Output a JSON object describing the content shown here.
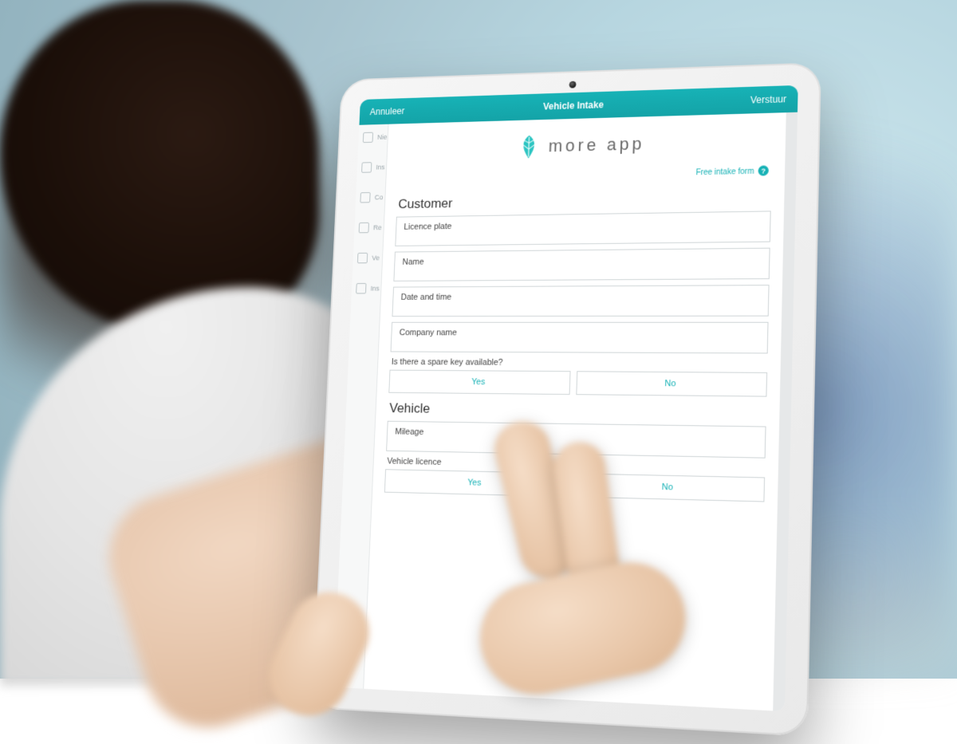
{
  "header": {
    "cancel": "Annuleer",
    "title": "Vehicle Intake",
    "send": "Verstuur"
  },
  "brand": {
    "name": "more app"
  },
  "help": {
    "label": "Free intake form",
    "mark": "?"
  },
  "sidebar": {
    "items": [
      "Nie",
      "Ins",
      "Co",
      "Re",
      "Ve",
      "Ins"
    ]
  },
  "sections": {
    "customer": {
      "title": "Customer",
      "fields": {
        "licence_plate": "Licence plate",
        "name": "Name",
        "date_time": "Date and time",
        "company_name": "Company name"
      },
      "spare_key_q": "Is there a spare key available?",
      "yes": "Yes",
      "no": "No"
    },
    "vehicle": {
      "title": "Vehicle",
      "fields": {
        "mileage": "Mileage"
      },
      "licence_q": "Vehicle licence",
      "yes": "Yes",
      "no": "No"
    }
  }
}
